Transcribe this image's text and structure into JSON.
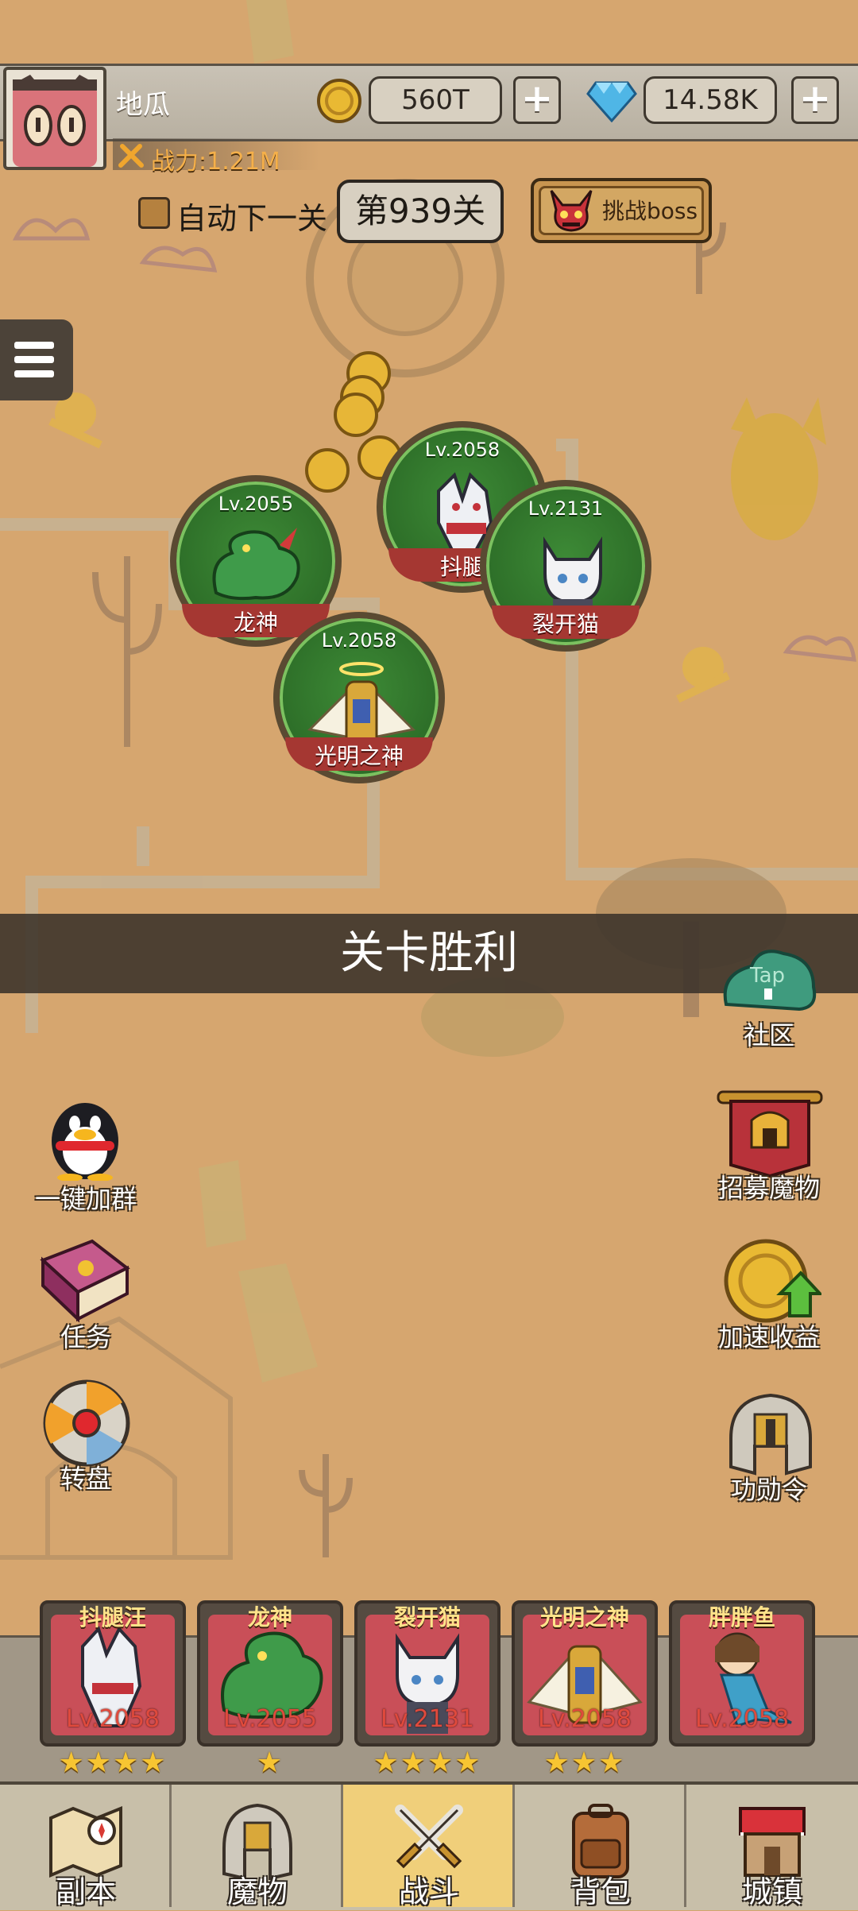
{
  "player": {
    "name": "地瓜",
    "power": "战力:1.21M",
    "coins": "560T",
    "diamonds": "14.58K",
    "add_symbol": "+"
  },
  "stage": {
    "auto_next_label": "自动下一关",
    "level": "第939关",
    "boss_button": "挑战boss"
  },
  "heroes_on_map": [
    {
      "name": "龙神",
      "level": "Lv.2055"
    },
    {
      "name": "抖腿",
      "level": "Lv.2058"
    },
    {
      "name": "裂开猫",
      "level": "Lv.2131"
    },
    {
      "name": "光明之神",
      "level": "Lv.2058"
    }
  ],
  "banner": {
    "text": "关卡胜利"
  },
  "side_left": [
    {
      "label": "一键加群",
      "icon": "penguin-icon"
    },
    {
      "label": "任务",
      "icon": "book-icon"
    },
    {
      "label": "转盘",
      "icon": "wheel-icon"
    }
  ],
  "side_right": [
    {
      "label": "社区",
      "icon": "tap-icon",
      "icon_text": "Tap"
    },
    {
      "label": "招募魔物",
      "icon": "banner-helmet-icon"
    },
    {
      "label": "加速收益",
      "icon": "coin-arrow-icon"
    },
    {
      "label": "功勋令",
      "icon": "helmet-icon"
    }
  ],
  "team": [
    {
      "name": "抖腿汪",
      "level": "Lv.2058",
      "stars": "★★★★"
    },
    {
      "name": "龙神",
      "level": "Lv.2055",
      "stars": "★"
    },
    {
      "name": "裂开猫",
      "level": "Lv.2131",
      "stars": "★★★★"
    },
    {
      "name": "光明之神",
      "level": "Lv.2058",
      "stars": "★★★"
    },
    {
      "name": "胖胖鱼",
      "level": "Lv.2058",
      "stars": ""
    }
  ],
  "nav": [
    {
      "label": "副本",
      "icon": "map-icon"
    },
    {
      "label": "魔物",
      "icon": "knight-helmet-icon"
    },
    {
      "label": "战斗",
      "icon": "crossed-swords-icon",
      "active": true
    },
    {
      "label": "背包",
      "icon": "backpack-icon"
    },
    {
      "label": "城镇",
      "icon": "shop-icon"
    }
  ],
  "colors": {
    "ground": "#d5a56e",
    "hero_ring": "#2d6e28",
    "name_band": "#a53732",
    "gold": "#f7c532",
    "active_tab": "#f0cf7a"
  }
}
